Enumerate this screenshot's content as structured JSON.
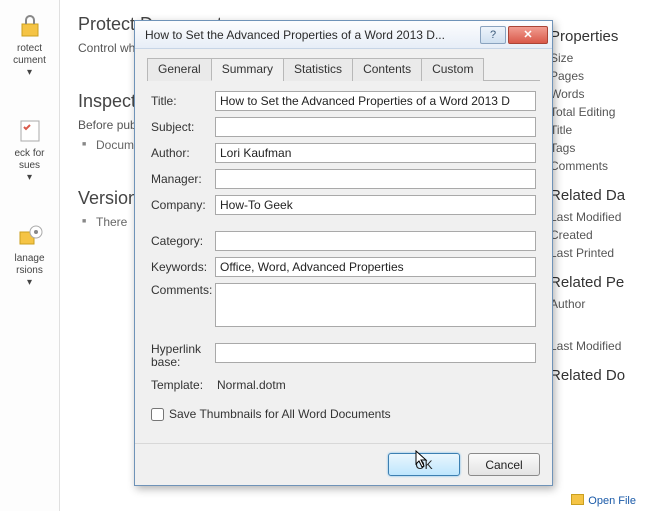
{
  "background": {
    "ribbon": {
      "protect": {
        "line1": "rotect",
        "line2": "cument"
      },
      "check": {
        "line1": "eck for",
        "line2": "sues"
      },
      "manage": {
        "line1": "lanage",
        "line2": "rsions"
      }
    },
    "sections": {
      "protect": {
        "title": "Protect Document",
        "desc": "Control wh"
      },
      "inspect": {
        "title": "Inspect",
        "desc": "Before publ",
        "item": "Docum"
      },
      "versions": {
        "title": "Version",
        "item": "There"
      }
    },
    "properties": {
      "header1": "Properties",
      "size": "Size",
      "pages": "Pages",
      "words": "Words",
      "total_editing": "Total Editing",
      "title": "Title",
      "tags": "Tags",
      "comments": "Comments",
      "header2": "Related Da",
      "last_modified": "Last Modified",
      "created": "Created",
      "last_printed": "Last Printed",
      "header3": "Related Pe",
      "author": "Author",
      "last_modified2": "Last Modified",
      "header4": "Related Do",
      "open_file": "Open File"
    }
  },
  "dialog": {
    "title": "How to Set the Advanced Properties of a Word 2013 D...",
    "tabs": {
      "general": "General",
      "summary": "Summary",
      "statistics": "Statistics",
      "contents": "Contents",
      "custom": "Custom"
    },
    "labels": {
      "title": "Title:",
      "subject": "Subject:",
      "author": "Author:",
      "manager": "Manager:",
      "company": "Company:",
      "category": "Category:",
      "keywords": "Keywords:",
      "comments": "Comments:",
      "hyperlink": "Hyperlink base:",
      "template": "Template:"
    },
    "values": {
      "title": "How to Set the Advanced Properties of a Word 2013 D",
      "subject": "",
      "author": "Lori Kaufman",
      "manager": "",
      "company": "How-To Geek",
      "category": "",
      "keywords": "Office, Word, Advanced Properties",
      "comments": "",
      "hyperlink": "",
      "template": "Normal.dotm"
    },
    "checkbox": "Save Thumbnails for All Word Documents",
    "buttons": {
      "ok": "OK",
      "cancel": "Cancel"
    }
  }
}
